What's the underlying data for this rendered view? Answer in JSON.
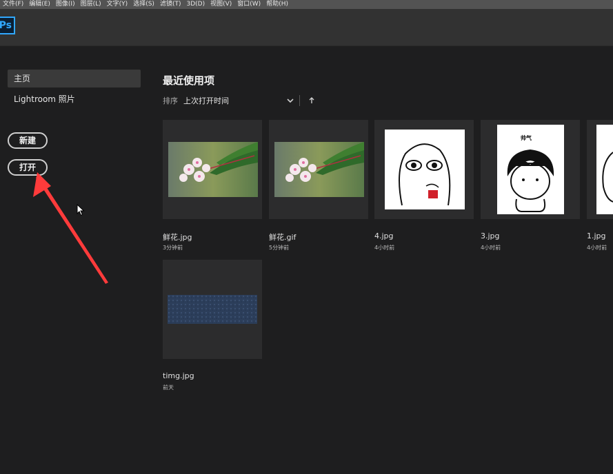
{
  "menu": [
    "文件(F)",
    "编辑(E)",
    "图像(I)",
    "图层(L)",
    "文字(Y)",
    "选择(S)",
    "滤镜(T)",
    "3D(D)",
    "视图(V)",
    "窗口(W)",
    "帮助(H)"
  ],
  "app": {
    "logo": "Ps"
  },
  "sidebar": {
    "items": [
      {
        "label": "主页",
        "active": true
      },
      {
        "label": "Lightroom 照片",
        "active": false
      }
    ],
    "new_button": "新建",
    "open_button": "打开"
  },
  "recent": {
    "title": "最近使用项",
    "sort_label": "排序",
    "sort_value": "上次打开时间",
    "files": [
      {
        "name": "鲜花.jpg",
        "time": "3分钟前"
      },
      {
        "name": "鲜花.gif",
        "time": "5分钟前"
      },
      {
        "name": "4.jpg",
        "time": "4小时前"
      },
      {
        "name": "3.jpg",
        "time": "4小时前",
        "caption": "帅气"
      },
      {
        "name": "1.jpg",
        "time": "4小时前"
      },
      {
        "name": "timg.jpg",
        "time": "前天"
      }
    ]
  },
  "colors": {
    "accent": "#31a8ff",
    "annotation": "#ff3b3b"
  }
}
